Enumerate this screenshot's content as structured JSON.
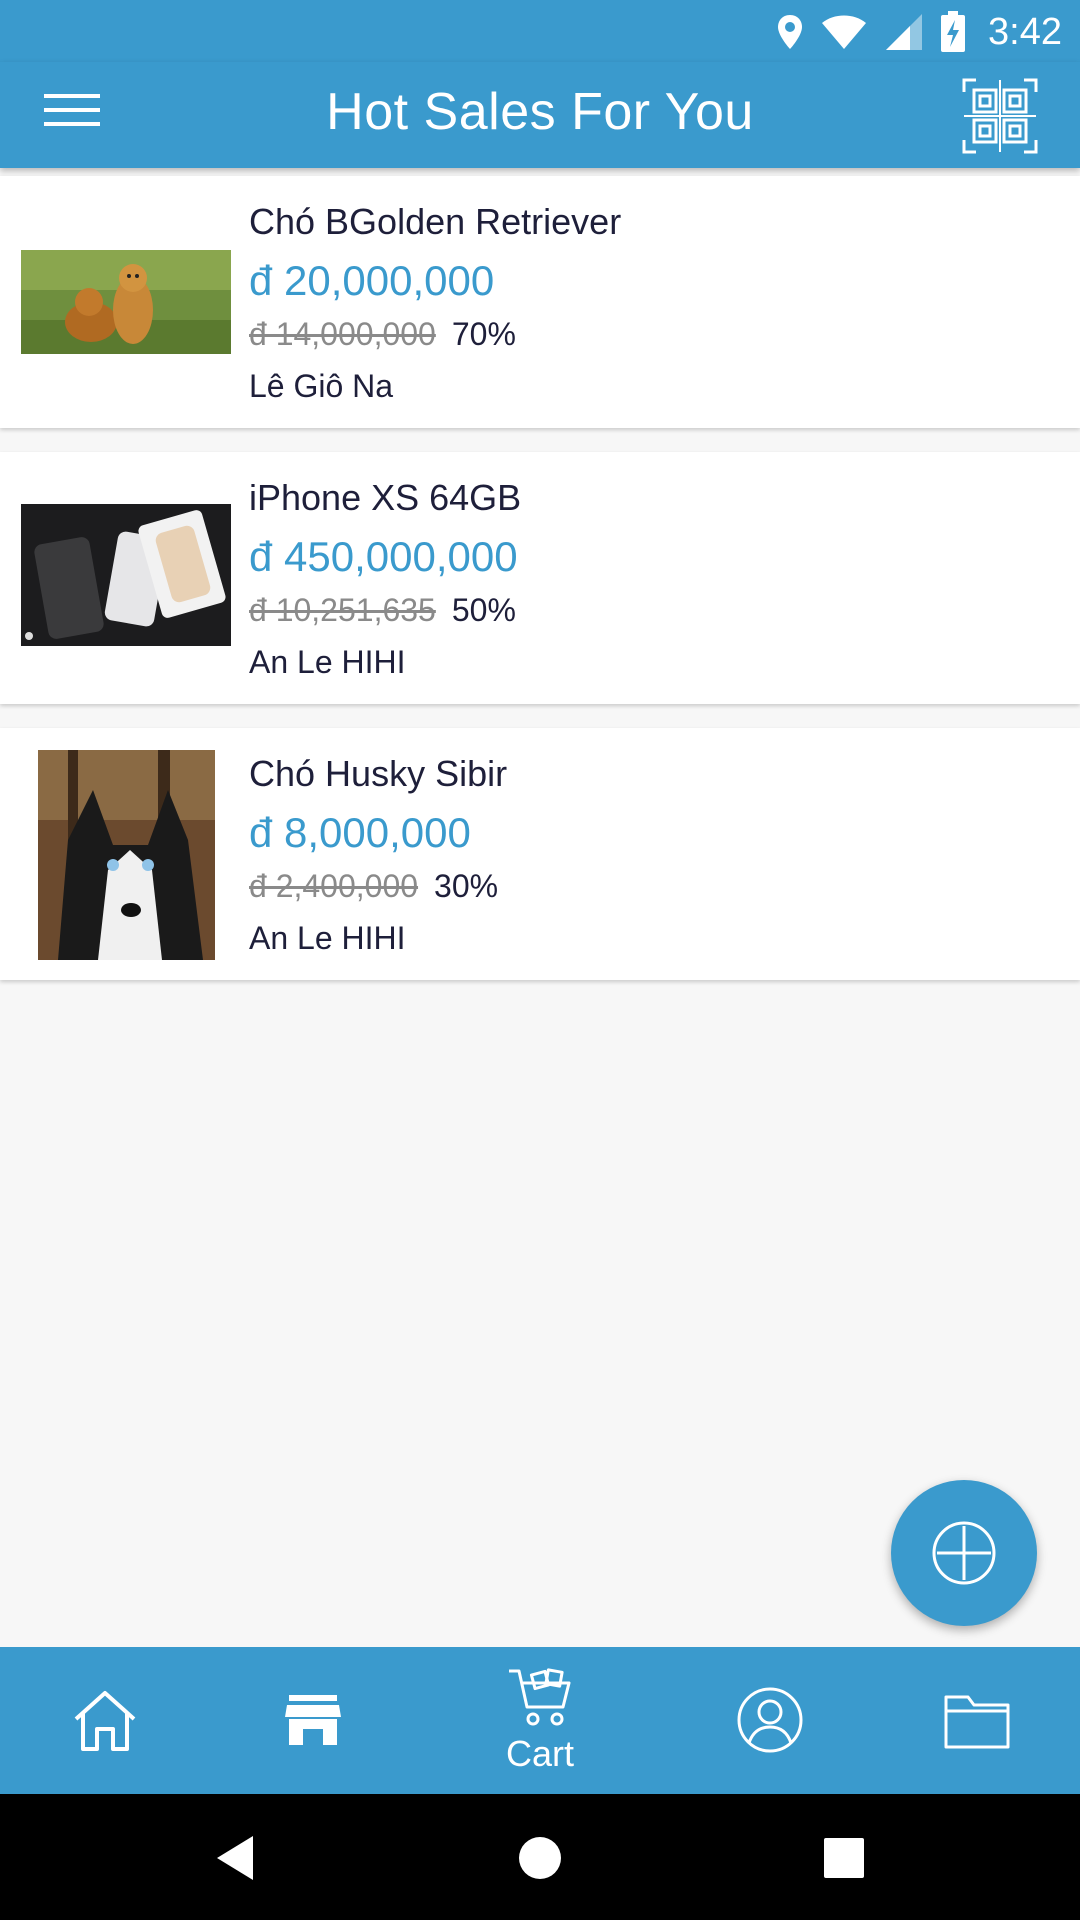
{
  "status_bar": {
    "time": "3:42"
  },
  "app_bar": {
    "title": "Hot Sales For You"
  },
  "products": [
    {
      "name": "Chó BGolden Retriever",
      "price": "đ 20,000,000",
      "old_price": "đ 14,000,000",
      "discount": "70%",
      "seller": "Lê Giô Na"
    },
    {
      "name": "iPhone XS 64GB",
      "price": "đ 450,000,000",
      "old_price": "đ 10,251,635",
      "discount": "50%",
      "seller": "An Le HIHI"
    },
    {
      "name": "Chó Husky Sibir",
      "price": "đ 8,000,000",
      "old_price": "đ 2,400,000",
      "discount": "30%",
      "seller": "An Le HIHI"
    }
  ],
  "bottom_nav": {
    "cart_label": "Cart"
  },
  "colors": {
    "primary": "#3a9acd",
    "text_dark": "#1e1f3a",
    "strike_gray": "#8a8a8a"
  }
}
